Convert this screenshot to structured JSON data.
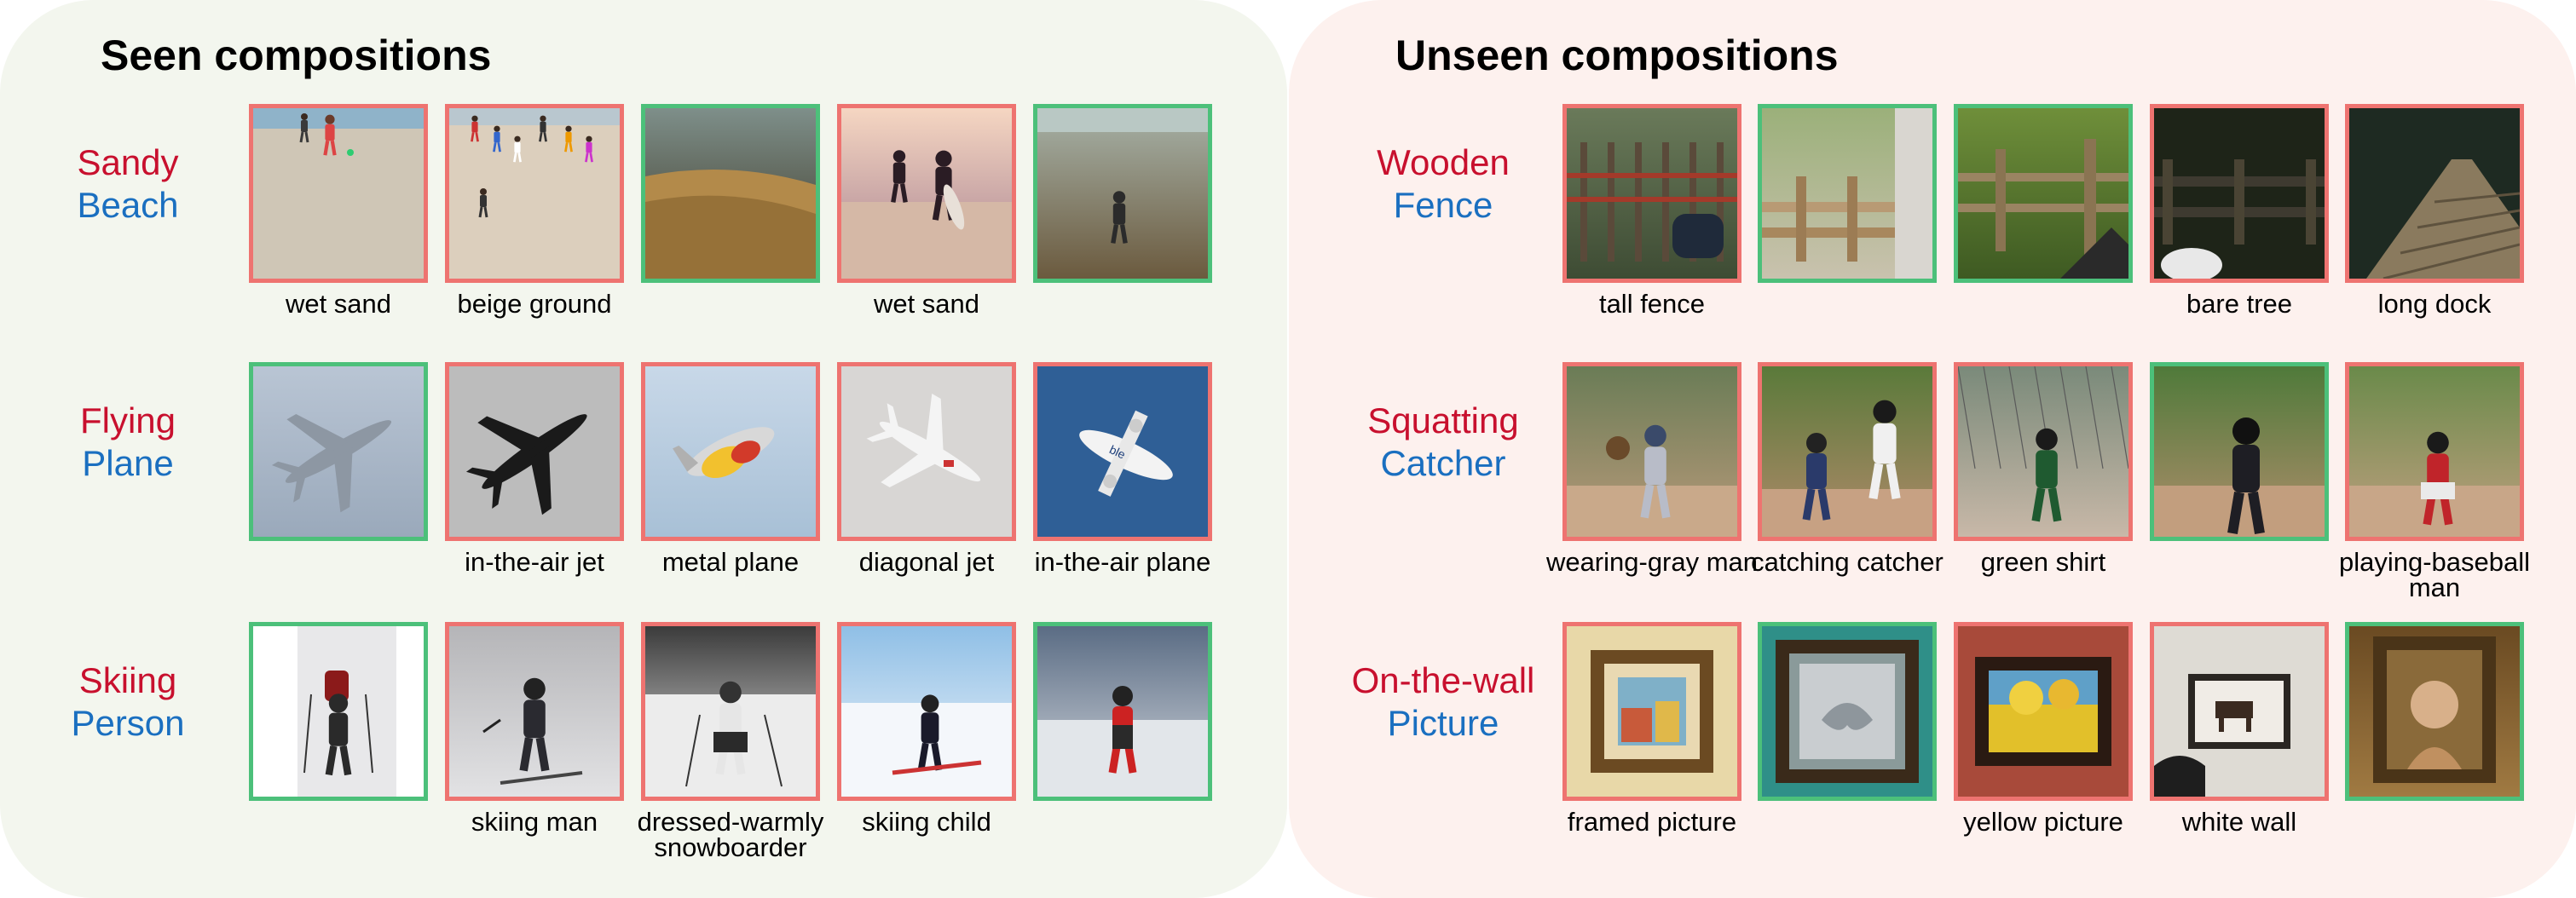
{
  "colors": {
    "seen_bg": "#f3f6ee",
    "unseen_bg": "#fdf1ee",
    "attribute_text": "#c8102e",
    "object_text": "#1a6fc0",
    "wrong_border": "#ee7370",
    "correct_border": "#4cc07a"
  },
  "seen": {
    "title": "Seen compositions",
    "rows": [
      {
        "attribute": "Sandy",
        "object": "Beach",
        "cells": [
          {
            "border": "red",
            "caption": "wet sand",
            "scene": "beach-people"
          },
          {
            "border": "red",
            "caption": "beige ground",
            "scene": "crowded-beach"
          },
          {
            "border": "green",
            "caption": "",
            "scene": "wet-shore"
          },
          {
            "border": "red",
            "caption": "wet sand",
            "scene": "surfers-beach"
          },
          {
            "border": "green",
            "caption": "",
            "scene": "lone-walker-beach"
          }
        ]
      },
      {
        "attribute": "Flying",
        "object": "Plane",
        "cells": [
          {
            "border": "green",
            "caption": "",
            "scene": "jet-underside"
          },
          {
            "border": "red",
            "caption": "in-the-air jet",
            "scene": "black-jet"
          },
          {
            "border": "red",
            "caption": "metal plane",
            "scene": "yellow-plane"
          },
          {
            "border": "red",
            "caption": "diagonal jet",
            "scene": "white-jet"
          },
          {
            "border": "red",
            "caption": "in-the-air plane",
            "scene": "propeller-plane"
          }
        ]
      },
      {
        "attribute": "Skiing",
        "object": "Person",
        "cells": [
          {
            "border": "green",
            "caption": "",
            "scene": "backpack-skier"
          },
          {
            "border": "red",
            "caption": "skiing man",
            "scene": "skier-dark"
          },
          {
            "border": "red",
            "caption": "dressed-warmly snowboarder",
            "scene": "skier-white"
          },
          {
            "border": "red",
            "caption": "skiing child",
            "scene": "child-skier"
          },
          {
            "border": "green",
            "caption": "",
            "scene": "red-skier"
          }
        ]
      }
    ]
  },
  "unseen": {
    "title": "Unseen compositions",
    "rows": [
      {
        "attribute": "Wooden",
        "object": "Fence",
        "cells": [
          {
            "border": "red",
            "caption": "tall fence",
            "scene": "forest-fence"
          },
          {
            "border": "green",
            "caption": "",
            "scene": "rail-phone"
          },
          {
            "border": "green",
            "caption": "",
            "scene": "grass-fence"
          },
          {
            "border": "red",
            "caption": "bare tree",
            "scene": "dark-fence"
          },
          {
            "border": "red",
            "caption": "long dock",
            "scene": "dock"
          }
        ]
      },
      {
        "attribute": "Squatting",
        "object": "Catcher",
        "cells": [
          {
            "border": "red",
            "caption": "wearing-gray man",
            "scene": "catcher-gray"
          },
          {
            "border": "red",
            "caption": "catching catcher",
            "scene": "catcher-blue"
          },
          {
            "border": "red",
            "caption": "green shirt",
            "scene": "batter-green"
          },
          {
            "border": "green",
            "caption": "",
            "scene": "umpire"
          },
          {
            "border": "red",
            "caption": "playing-baseball man",
            "scene": "catcher-red"
          }
        ]
      },
      {
        "attribute": "On-the-wall",
        "object": "Picture",
        "cells": [
          {
            "border": "red",
            "caption": "framed picture",
            "scene": "frame-gold"
          },
          {
            "border": "green",
            "caption": "",
            "scene": "frame-mirror"
          },
          {
            "border": "red",
            "caption": "yellow picture",
            "scene": "frame-yellow"
          },
          {
            "border": "red",
            "caption": "white wall",
            "scene": "frame-horse"
          },
          {
            "border": "green",
            "caption": "",
            "scene": "frame-portrait"
          }
        ]
      }
    ]
  }
}
